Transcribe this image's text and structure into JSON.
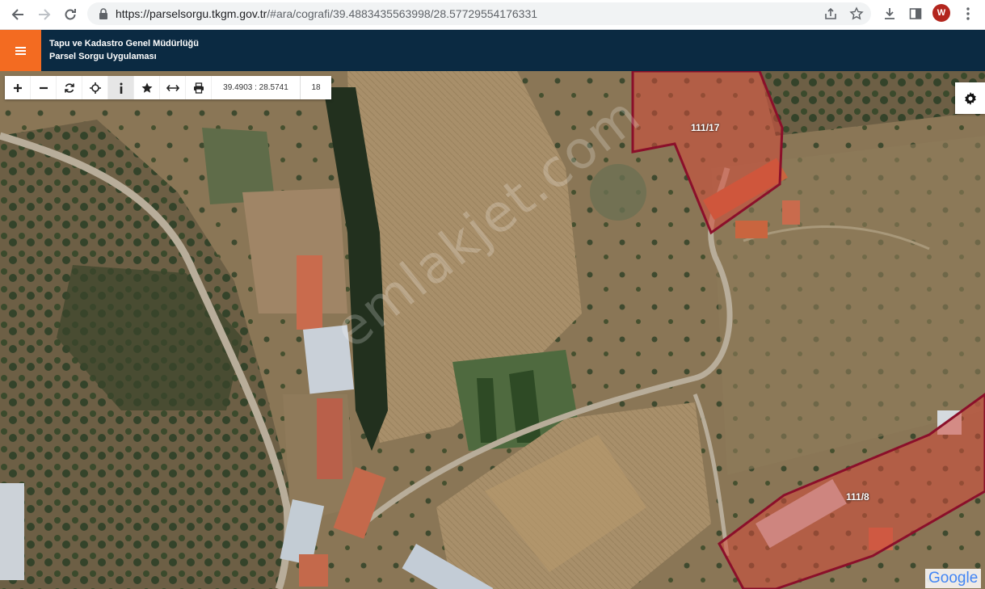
{
  "browser": {
    "url_host": "https://parselsorgu.tkgm.gov.tr",
    "url_path": "/#ara/cografi/39.4883435563998/28.57729554176331",
    "profile_initial": "W"
  },
  "app": {
    "title_line1": "Tapu ve Kadastro Genel Müdürlüğü",
    "title_line2": "Parsel Sorgu Uygulaması"
  },
  "toolbar": {
    "coordinates": "39.4903 : 28.5741",
    "zoom_level": "18",
    "tools": [
      "zoom-in",
      "zoom-out",
      "refresh",
      "locate",
      "info",
      "favorite",
      "measure",
      "print"
    ]
  },
  "parcels": [
    {
      "label": "111/17"
    },
    {
      "label": "111/8"
    }
  ],
  "watermark": "emlakjet.com",
  "attribution": "Google",
  "colors": {
    "header_bg": "#0b2a42",
    "menu_accent": "#f36b21",
    "parcel_border": "#8b0f2a",
    "parcel_fill": "#d44a3a"
  }
}
